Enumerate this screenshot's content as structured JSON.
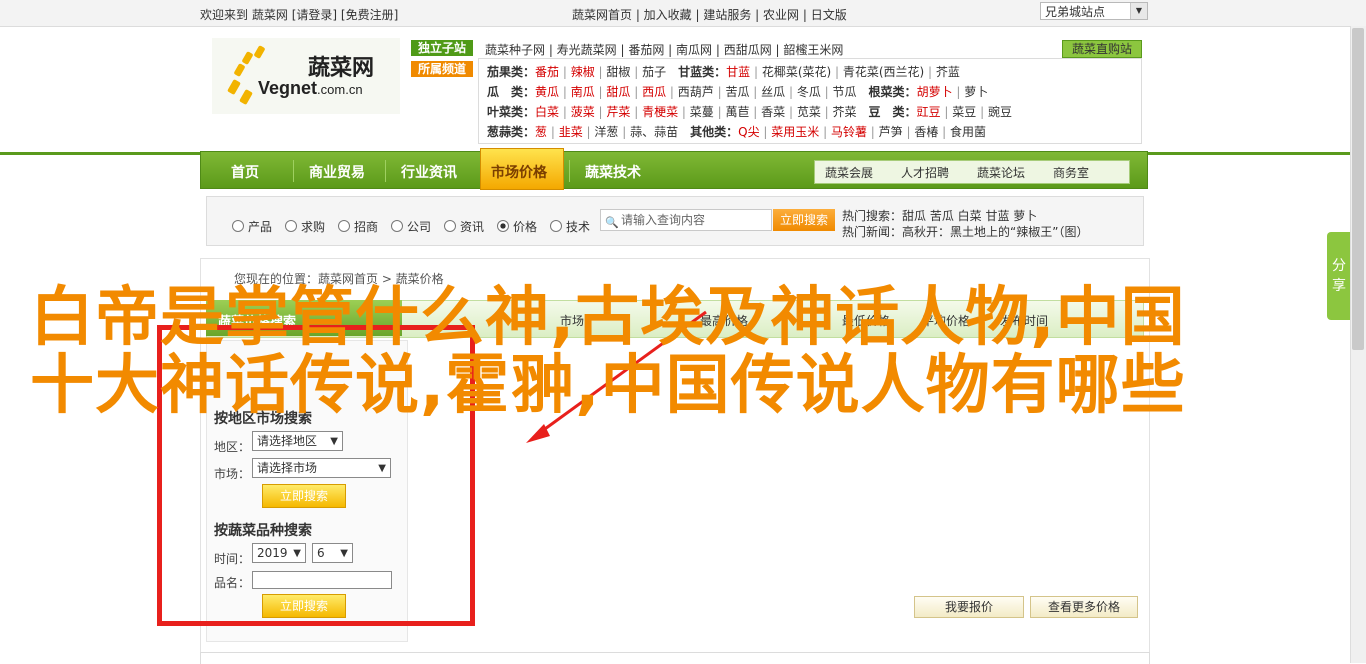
{
  "topbar": {
    "welcome": "欢迎来到",
    "site": "蔬菜网",
    "login": "[请登录]",
    "register": "[免费注册]",
    "links": "蔬菜网首页 | 加入收藏 | 建站服务 | 农业网 | 日文版",
    "city_select": "兄弟城站点"
  },
  "logo": {
    "cn": "蔬菜网",
    "en": "Vegnet",
    "domain": ".com.cn"
  },
  "tags": {
    "independent": "独立子站",
    "channel": "所属频道"
  },
  "independent_sites": "蔬菜种子网 | 寿光蔬菜网 | 番茄网 | 南瓜网 | 西甜瓜网 | 韶櫁王米网",
  "direct_link": "蔬菜直购站",
  "categories": [
    {
      "head": "茄果类：",
      "items": [
        "番茄",
        "辣椒",
        "甜椒",
        "茄子"
      ],
      "red": [
        0,
        1
      ],
      "head2": "甘蓝类：",
      "items2": [
        "甘蓝",
        "花椰菜(菜花)",
        "青花菜(西兰花)",
        "芥蓝"
      ],
      "red2": [
        0
      ]
    },
    {
      "head": "瓜　类：",
      "items": [
        "黄瓜",
        "南瓜",
        "甜瓜",
        "西瓜",
        "西葫芦",
        "苦瓜",
        "丝瓜",
        "冬瓜",
        "节瓜"
      ],
      "red": [
        0,
        1,
        2,
        3
      ],
      "head2": "根菜类：",
      "items2": [
        "胡萝卜",
        "萝卜"
      ],
      "red2": [
        0
      ]
    },
    {
      "head": "叶菜类：",
      "items": [
        "白菜",
        "菠菜",
        "芹菜",
        "青梗菜",
        "菜蔓",
        "萬苣",
        "香菜",
        "苋菜",
        "芥菜"
      ],
      "red": [
        0,
        1,
        2,
        3
      ],
      "head2": "豆　类：",
      "items2": [
        "豇豆",
        "菜豆",
        "豌豆"
      ],
      "red2": [
        0
      ]
    },
    {
      "head": "葱蒜类：",
      "items": [
        "葱",
        "韭菜",
        "洋葱",
        "蒜、蒜苗"
      ],
      "red": [
        0,
        1
      ],
      "head2": "其他类：",
      "items2": [
        "Q尖",
        "菜用玉米",
        "马铃薯",
        "芦笋",
        "香椿",
        "食用菌"
      ],
      "red2": [
        0,
        1,
        2
      ]
    }
  ],
  "nav": {
    "items": [
      "首页",
      "商业贸易",
      "行业资讯",
      "市场价格",
      "蔬菜技术"
    ],
    "active": "市场价格",
    "sub": [
      "蔬菜会展",
      "人才招聘",
      "蔬菜论坛",
      "商务室"
    ]
  },
  "search": {
    "options": [
      "产品",
      "求购",
      "招商",
      "公司",
      "资讯",
      "价格",
      "技术"
    ],
    "selected": "价格",
    "placeholder": "请输入查询内容",
    "button": "立即搜索",
    "hot_label": "热门搜索：",
    "hot": "甜瓜  苦瓜  白菜  甘蓝  萝卜",
    "news_label": "热门新闻：",
    "news": "高秋开：黑土地上的“辣椒王”（图）"
  },
  "breadcrumb": "您现在的位置：蔬菜网首页 > 蔬菜价格",
  "sidebar_tab": "蔬菜价格搜索",
  "columns": [
    "市场",
    "最高价格",
    "最低价格",
    "平均价格",
    "发布时间"
  ],
  "region_search": {
    "title": "按地区市场搜索",
    "region_label": "地区：",
    "region_value": "请选择地区",
    "market_label": "市场：",
    "market_value": "请选择市场",
    "button": "立即搜索"
  },
  "variety_search": {
    "title": "按蔬菜品种搜索",
    "time_label": "时间：",
    "year": "2019",
    "month": "6",
    "name_label": "品名：",
    "button": "立即搜索"
  },
  "price_buttons": {
    "report": "我要报价",
    "more": "查看更多价格"
  },
  "overlay_title": {
    "line1": "白帝是掌管什么神,古埃及神话人物,中国",
    "line2": "十大神话传说,霍翀,中国传说人物有哪些"
  },
  "share": "分享",
  "colors": {
    "brand_green": "#5c9a1a",
    "accent_orange": "#f08a00",
    "overlay": "#f28a00",
    "annotation_red": "#e8201c"
  }
}
